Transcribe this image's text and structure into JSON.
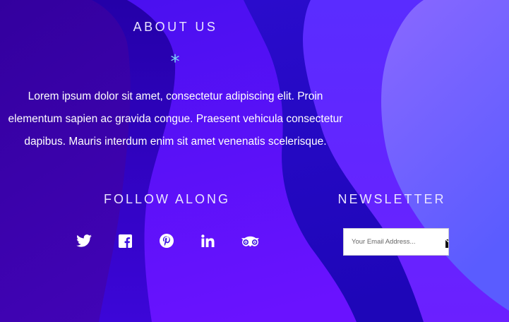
{
  "about": {
    "title": "ABOUT US",
    "separator": "*",
    "text": "Lorem ipsum dolor sit amet, consectetur adipiscing elit. Proin elementum sapien ac gravida congue. Praesent vehicula consectetur dapibus. Mauris interdum enim sit amet venenatis scelerisque."
  },
  "follow": {
    "title": "FOLLOW ALONG",
    "icons": [
      "twitter-icon",
      "facebook-icon",
      "pinterest-icon",
      "linkedin-icon",
      "tripadvisor-icon"
    ]
  },
  "newsletter": {
    "title": "NEWSLETTER",
    "placeholder": "Your Email Address...",
    "value": "",
    "submit_icon": "envelope-icon"
  },
  "colors": {
    "background_dark": "#2a00a8",
    "background_mid": "#4a10e8",
    "background_light": "#7a5cff",
    "accent_star": "#7ed6f6",
    "heading_text": "#e9e4ff",
    "body_text": "#ffffff"
  }
}
